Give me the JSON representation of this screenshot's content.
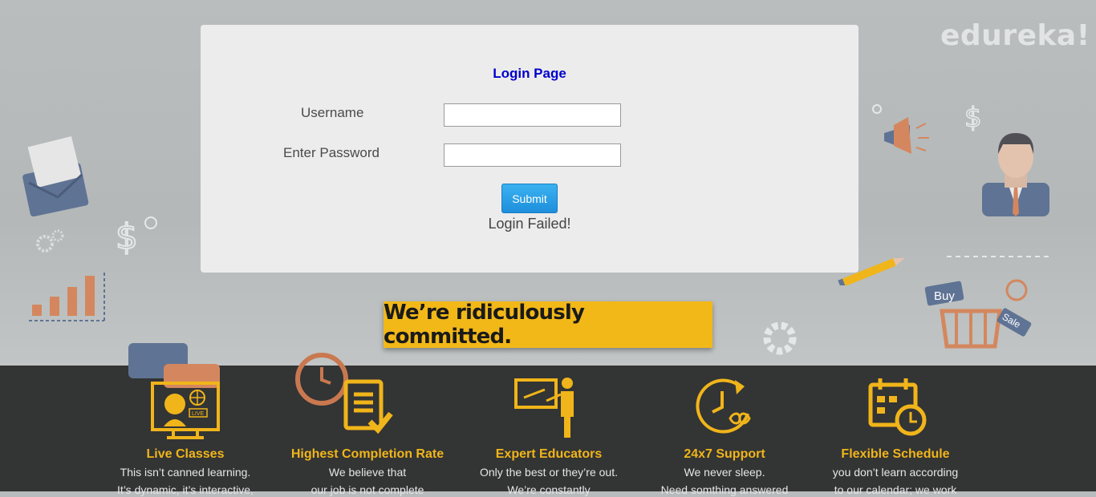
{
  "brand": {
    "logo_text": "edureka!"
  },
  "login": {
    "title": "Login Page",
    "username_label": "Username",
    "password_label": "Enter Password",
    "username_value": "",
    "password_value": "",
    "submit_label": "Submit",
    "status_text": "Login Failed!"
  },
  "banner": {
    "text": "We’re ridiculously committed."
  },
  "features": [
    {
      "icon": "live-classes-icon",
      "title": "Live Classes",
      "desc_line1": "This isn’t canned learning.",
      "desc_line2": "It’s dynamic, it’s interactive,"
    },
    {
      "icon": "completion-checklist-icon",
      "title": "Highest Completion Rate",
      "desc_line1": "We believe that",
      "desc_line2": "our job is not complete"
    },
    {
      "icon": "educator-board-icon",
      "title": "Expert Educators",
      "desc_line1": "Only the best or they’re out.",
      "desc_line2": "We’re constantly"
    },
    {
      "icon": "clock-infinity-icon",
      "title": "24x7 Support",
      "desc_line1": "We never sleep.",
      "desc_line2": "Need somthing answered"
    },
    {
      "icon": "calendar-clock-icon",
      "title": "Flexible Schedule",
      "desc_line1": "you don’t learn according",
      "desc_line2": "to our calendar; we work"
    }
  ],
  "decor": {
    "buy_tag": "Buy",
    "sale_tag": "Sale",
    "live_badge": "LIVE"
  },
  "colors": {
    "accent_yellow": "#f2b818",
    "title_blue": "#0000cc",
    "button_blue": "#1e8fdc",
    "footer_dark": "#333434"
  }
}
